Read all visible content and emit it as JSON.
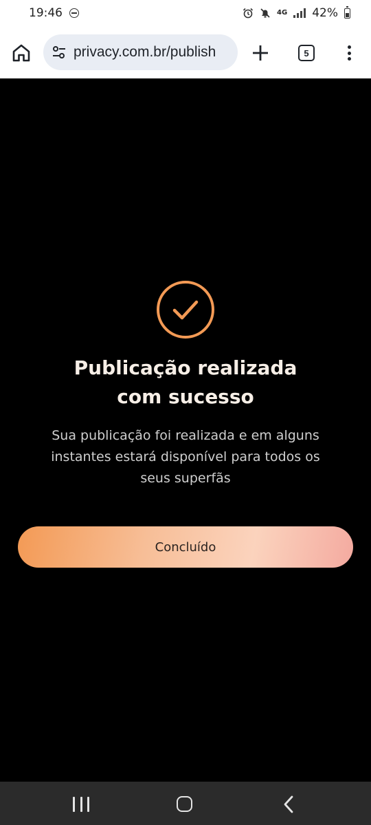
{
  "status_bar": {
    "time": "19:46",
    "network": "4G",
    "battery": "42%",
    "icons": [
      "do-not-disturb-icon",
      "alarm-icon",
      "mute-icon",
      "data-arrows-icon",
      "signal-icon",
      "battery-icon"
    ]
  },
  "browser": {
    "url": "privacy.com.br/publish",
    "tab_count": "5",
    "icons": [
      "home-icon",
      "site-settings-icon",
      "plus-icon",
      "tabs-icon",
      "more-vert-icon"
    ]
  },
  "success": {
    "icon": "check-circle-icon",
    "title_line1": "Publicação realizada",
    "title_line2": "com sucesso",
    "message_line1": "Sua publicação foi realizada e em alguns",
    "message_line2": "instantes estará disponível para todos os",
    "message_line3": "seus superfãs",
    "button_label": "Concluído"
  },
  "colors": {
    "accent": "#f39a55",
    "background": "#000000",
    "title_text": "#f7efe7"
  },
  "nav_bar": {
    "icons": [
      "recents-icon",
      "home-nav-icon",
      "back-icon"
    ]
  }
}
